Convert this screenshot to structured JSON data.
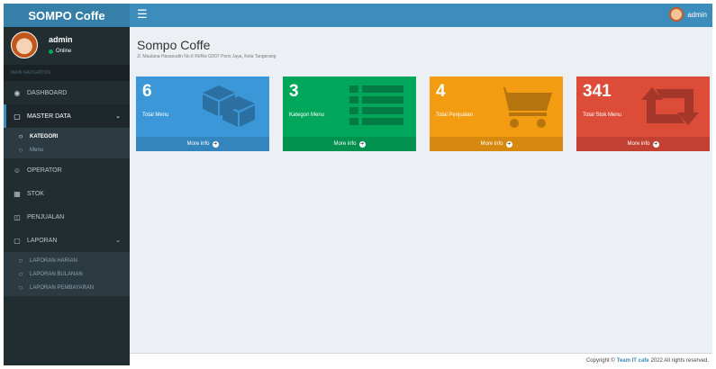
{
  "brand": {
    "title": "SOMPO Coffe"
  },
  "topbar": {
    "menu_icon": "hamburger-icon",
    "user_name": "admin"
  },
  "sidebar": {
    "user": {
      "name": "admin",
      "status": "Online"
    },
    "nav_header": "MAIN NAVIGATION",
    "items": [
      {
        "label": "DASHBOARD",
        "icon": "dashboard-icon"
      },
      {
        "label": "MASTER DATA",
        "icon": "folder-icon",
        "active": true,
        "expanded": true
      },
      {
        "label": "OPERATOR",
        "icon": "user-circle-icon"
      },
      {
        "label": "STOK",
        "icon": "cubes-icon"
      },
      {
        "label": "PENJUALAN",
        "icon": "cart-icon"
      },
      {
        "label": "LAPORAN",
        "icon": "folder-icon",
        "expanded": true
      }
    ],
    "master_sub": [
      {
        "label": "KATEGORI"
      },
      {
        "label": "Menu"
      }
    ],
    "laporan_sub": [
      {
        "label": "LAPORAN HARIAN"
      },
      {
        "label": "LAPORAN BULANAN"
      },
      {
        "label": "LAPORAN PEMBAYARAN"
      }
    ]
  },
  "main": {
    "title": "Sompo Coffe",
    "subtitle": "Jl. Maulana Hasanudin No.6 Rt/Rw 02/07 Poris Jaya, Kota Tangerang",
    "boxes": [
      {
        "value": "6",
        "label": "Total Menu",
        "more": "More info",
        "color": "#3c97d8",
        "icon": "cubes-icon"
      },
      {
        "value": "3",
        "label": "Kategori Menu",
        "more": "More info",
        "color": "#00a65a",
        "icon": "list-icon"
      },
      {
        "value": "4",
        "label": "Total Penjualan",
        "more": "More info",
        "color": "#f39c12",
        "icon": "cart-icon"
      },
      {
        "value": "341",
        "label": "Total Stok Menu",
        "more": "More info",
        "color": "#dd4b39",
        "icon": "retweet-icon"
      }
    ]
  },
  "footer": {
    "prefix": "Copyright ©",
    "team": "Team IT cafe",
    "suffix": "2022 All rights reserved."
  }
}
